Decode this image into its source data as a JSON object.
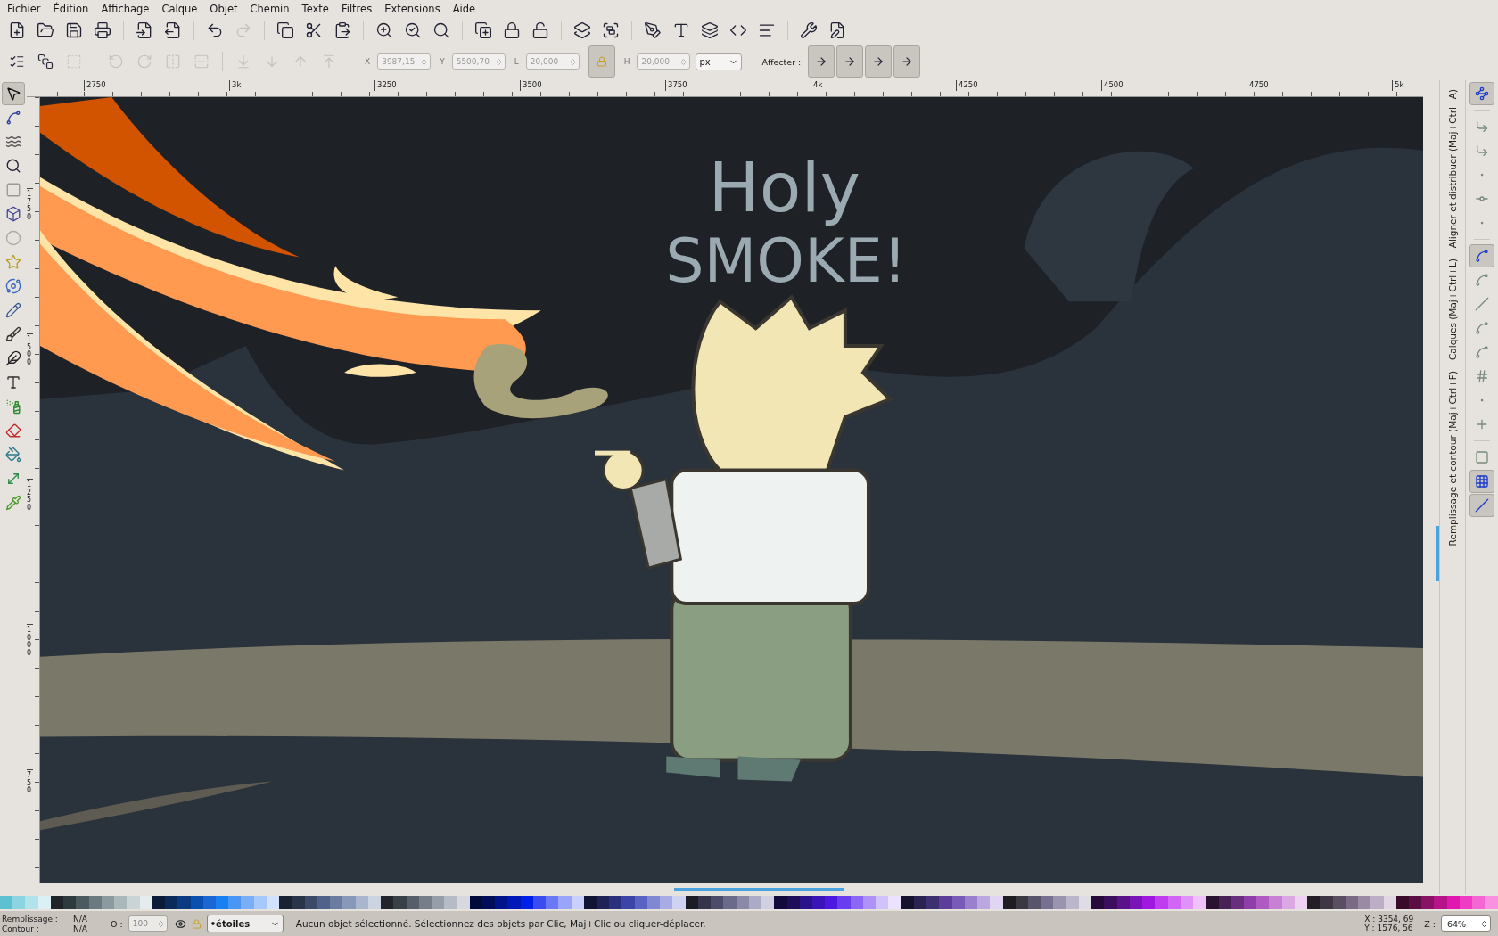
{
  "menu": [
    "Fichier",
    "Édition",
    "Affichage",
    "Calque",
    "Objet",
    "Chemin",
    "Texte",
    "Filtres",
    "Extensions",
    "Aide"
  ],
  "main_toolbar": [
    {
      "buttons": [
        {
          "disabled": false
        },
        {
          "disabled": false
        },
        {
          "disabled": false
        },
        {
          "disabled": false
        }
      ]
    },
    {
      "buttons": [
        {
          "disabled": false
        },
        {
          "disabled": false
        }
      ]
    },
    {
      "buttons": [
        {
          "disabled": false
        },
        {
          "disabled": true
        }
      ]
    },
    {
      "buttons": [
        {
          "disabled": false
        },
        {
          "disabled": false
        },
        {
          "disabled": false
        }
      ]
    },
    {
      "buttons": [
        {
          "disabled": false
        },
        {
          "disabled": false
        },
        {
          "disabled": false
        }
      ]
    },
    {
      "buttons": [
        {
          "disabled": false
        },
        {
          "disabled": false
        },
        {
          "disabled": false
        }
      ]
    },
    {
      "buttons": [
        {
          "disabled": false
        },
        {
          "disabled": false
        }
      ]
    },
    {
      "buttons": [
        {
          "disabled": false
        },
        {
          "disabled": false
        },
        {
          "disabled": false
        },
        {
          "disabled": false
        },
        {
          "disabled": false
        }
      ]
    },
    {
      "buttons": [
        {
          "disabled": false
        },
        {
          "disabled": false
        }
      ]
    }
  ],
  "select_toolbar": {
    "groups": [
      {
        "buttons": [
          {
            "disabled": false
          },
          {
            "disabled": false
          },
          {
            "disabled": true
          }
        ]
      },
      {
        "buttons": [
          {
            "disabled": true
          },
          {
            "disabled": true
          },
          {
            "disabled": true
          },
          {
            "disabled": true
          }
        ]
      },
      {
        "buttons": [
          {
            "disabled": true
          },
          {
            "disabled": true
          },
          {
            "disabled": true
          },
          {
            "disabled": true
          }
        ]
      }
    ],
    "fields": [
      {
        "label": "X",
        "value": "3987,15"
      },
      {
        "label": "Y",
        "value": "5500,70"
      },
      {
        "label": "L",
        "value": "20,000"
      }
    ],
    "lock": {
      "on": true
    },
    "h_field": {
      "label": "H",
      "value": "20,000"
    },
    "unit": "px",
    "affect_label": "Affecter :",
    "affect_buttons": [
      {
        "on": true
      },
      {
        "on": true
      },
      {
        "on": true
      },
      {
        "on": true
      }
    ]
  },
  "tools": [
    {
      "selected": true
    },
    {
      "selected": false
    },
    {
      "selected": false
    },
    {
      "selected": false
    },
    {
      "selected": false
    },
    {
      "selected": false
    },
    {
      "selected": false
    },
    {
      "selected": false
    },
    {
      "selected": false
    },
    {
      "selected": false
    },
    {
      "selected": false
    },
    {
      "selected": false
    },
    {
      "selected": false
    },
    {
      "selected": false
    },
    {
      "selected": false
    },
    {
      "selected": false
    },
    {
      "selected": false
    },
    {
      "selected": false
    }
  ],
  "h_ruler": [
    "2750",
    "3k",
    "3250",
    "3500",
    "3750",
    "4k",
    "4250",
    "4500",
    "4750",
    "5k"
  ],
  "v_ruler": [
    "1750",
    "1500",
    "1250",
    "1000",
    "750"
  ],
  "canvas": {
    "texts": [
      "Holy",
      "SMOKE!"
    ]
  },
  "dock_tabs": [
    "Aligner et distribuer (Maj+Ctrl+A)",
    "Calques (Maj+Ctrl+L)",
    "Remplissage et contour (Maj+Ctrl+F)"
  ],
  "snap_toolbar": [
    {
      "buttons": [
        {
          "on": true
        }
      ]
    },
    {
      "buttons": [
        {
          "on": false
        },
        {
          "on": false
        },
        {
          "on": false
        },
        {
          "on": false
        },
        {
          "on": false
        }
      ]
    },
    {
      "buttons": [
        {
          "on": true
        },
        {
          "on": false
        },
        {
          "on": false
        },
        {
          "on": false
        },
        {
          "on": false
        },
        {
          "on": false
        },
        {
          "on": false
        },
        {
          "on": false
        }
      ]
    },
    {
      "buttons": [
        {
          "on": false
        },
        {
          "on": true
        },
        {
          "on": true
        }
      ]
    }
  ],
  "palette": [
    {
      "color": "#5cc2d2"
    },
    {
      "color": "#8cd4e0"
    },
    {
      "color": "#b2e2ea"
    },
    {
      "color": "#daf0f4"
    },
    {
      "color": "#1e2428"
    },
    {
      "color": "#2e3a3e"
    },
    {
      "color": "#4a5a5e"
    },
    {
      "color": "#6a7a7e"
    },
    {
      "color": "#8a9a9e"
    },
    {
      "color": "#aab8bc"
    },
    {
      "color": "#cad4d6"
    },
    {
      "color": "#e6ecee"
    },
    {
      "color": "#0a1a38"
    },
    {
      "color": "#0a2a5a"
    },
    {
      "color": "#0a3a82"
    },
    {
      "color": "#0a50b0"
    },
    {
      "color": "#1a66d2"
    },
    {
      "color": "#1a80f2"
    },
    {
      "color": "#4a96f4"
    },
    {
      "color": "#7aaef6"
    },
    {
      "color": "#a6c8fa"
    },
    {
      "color": "#d2e2fc"
    },
    {
      "color": "#1a2232"
    },
    {
      "color": "#2a3448"
    },
    {
      "color": "#3a4a68"
    },
    {
      "color": "#50628a"
    },
    {
      "color": "#6a7ca0"
    },
    {
      "color": "#8898b8"
    },
    {
      "color": "#aab6cc"
    },
    {
      "color": "#ccd4e2"
    },
    {
      "color": "#22262c"
    },
    {
      "color": "#3a4048"
    },
    {
      "color": "#565e6a"
    },
    {
      "color": "#767e8a"
    },
    {
      "color": "#969eaa"
    },
    {
      "color": "#b6bcc6"
    },
    {
      "color": "#d6dae0"
    },
    {
      "color": "#000a3a"
    },
    {
      "color": "#000e5a"
    },
    {
      "color": "#00148a"
    },
    {
      "color": "#0018b8"
    },
    {
      "color": "#0020e8"
    },
    {
      "color": "#3a4cf0"
    },
    {
      "color": "#6a78f4"
    },
    {
      "color": "#9aa4f8"
    },
    {
      "color": "#cad0fc"
    },
    {
      "color": "#121436"
    },
    {
      "color": "#1e2256"
    },
    {
      "color": "#2a307e"
    },
    {
      "color": "#3c44a8"
    },
    {
      "color": "#5a62c2"
    },
    {
      "color": "#8088d4"
    },
    {
      "color": "#a8ace4"
    },
    {
      "color": "#d0d2f2"
    },
    {
      "color": "#1c1c26"
    },
    {
      "color": "#34344a"
    },
    {
      "color": "#4c4c6a"
    },
    {
      "color": "#6a6a8a"
    },
    {
      "color": "#8a8aa8"
    },
    {
      "color": "#ababc6"
    },
    {
      "color": "#d0d0e2"
    },
    {
      "color": "#120a3a"
    },
    {
      "color": "#1e0e5a"
    },
    {
      "color": "#2a128a"
    },
    {
      "color": "#3a14b8"
    },
    {
      "color": "#4c18e0"
    },
    {
      "color": "#6a3cf0"
    },
    {
      "color": "#8c66f4"
    },
    {
      "color": "#ae92f8"
    },
    {
      "color": "#d2c2fc"
    },
    {
      "color": "#eae2fe"
    },
    {
      "color": "#16122e"
    },
    {
      "color": "#2a2250"
    },
    {
      "color": "#3c3070"
    },
    {
      "color": "#5a3e9a"
    },
    {
      "color": "#7a5ab8"
    },
    {
      "color": "#9a80cc"
    },
    {
      "color": "#bca8e0"
    },
    {
      "color": "#e0d6f2"
    },
    {
      "color": "#1e1e22"
    },
    {
      "color": "#3a3840"
    },
    {
      "color": "#58546a"
    },
    {
      "color": "#787090"
    },
    {
      "color": "#9a94ae"
    },
    {
      "color": "#bcb6ca"
    },
    {
      "color": "#e0dce6"
    },
    {
      "color": "#260a3a"
    },
    {
      "color": "#3e0e5e"
    },
    {
      "color": "#5a128a"
    },
    {
      "color": "#7a14b8"
    },
    {
      "color": "#a018e0"
    },
    {
      "color": "#c03cf0"
    },
    {
      "color": "#d266f4"
    },
    {
      "color": "#e092f8"
    },
    {
      "color": "#f0c2fc"
    },
    {
      "color": "#2a1232"
    },
    {
      "color": "#482256"
    },
    {
      "color": "#6a2e7e"
    },
    {
      "color": "#8e3ea8"
    },
    {
      "color": "#ae5ac2"
    },
    {
      "color": "#c880d4"
    },
    {
      "color": "#dca8e4"
    },
    {
      "color": "#eed2f2"
    },
    {
      "color": "#221e24"
    },
    {
      "color": "#3e3642"
    },
    {
      "color": "#5a4e62"
    },
    {
      "color": "#7a6a84"
    },
    {
      "color": "#9a8aa4"
    },
    {
      "color": "#bcaec4"
    },
    {
      "color": "#e0d6e4"
    },
    {
      "color": "#3a0a2a"
    },
    {
      "color": "#5a0e42"
    },
    {
      "color": "#8a1266"
    },
    {
      "color": "#b8148a"
    },
    {
      "color": "#e018b0"
    },
    {
      "color": "#f03cc4"
    },
    {
      "color": "#f466d2"
    },
    {
      "color": "#f892e0"
    }
  ],
  "status": {
    "fill_label": "Remplissage :",
    "fill_value": "N/A",
    "stroke_label": "Contour :",
    "stroke_value": "N/A",
    "opacity_label": "O :",
    "opacity_value": "100",
    "layer": "•étoiles",
    "message": "Aucun objet sélectionné. Sélectionnez des objets par Clic, Maj+Clic ou cliquer-déplacer.",
    "x": "X : 3354, 69",
    "y": "Y : 1576, 56",
    "zoom_label": "Z :",
    "zoom_value": "64%"
  }
}
